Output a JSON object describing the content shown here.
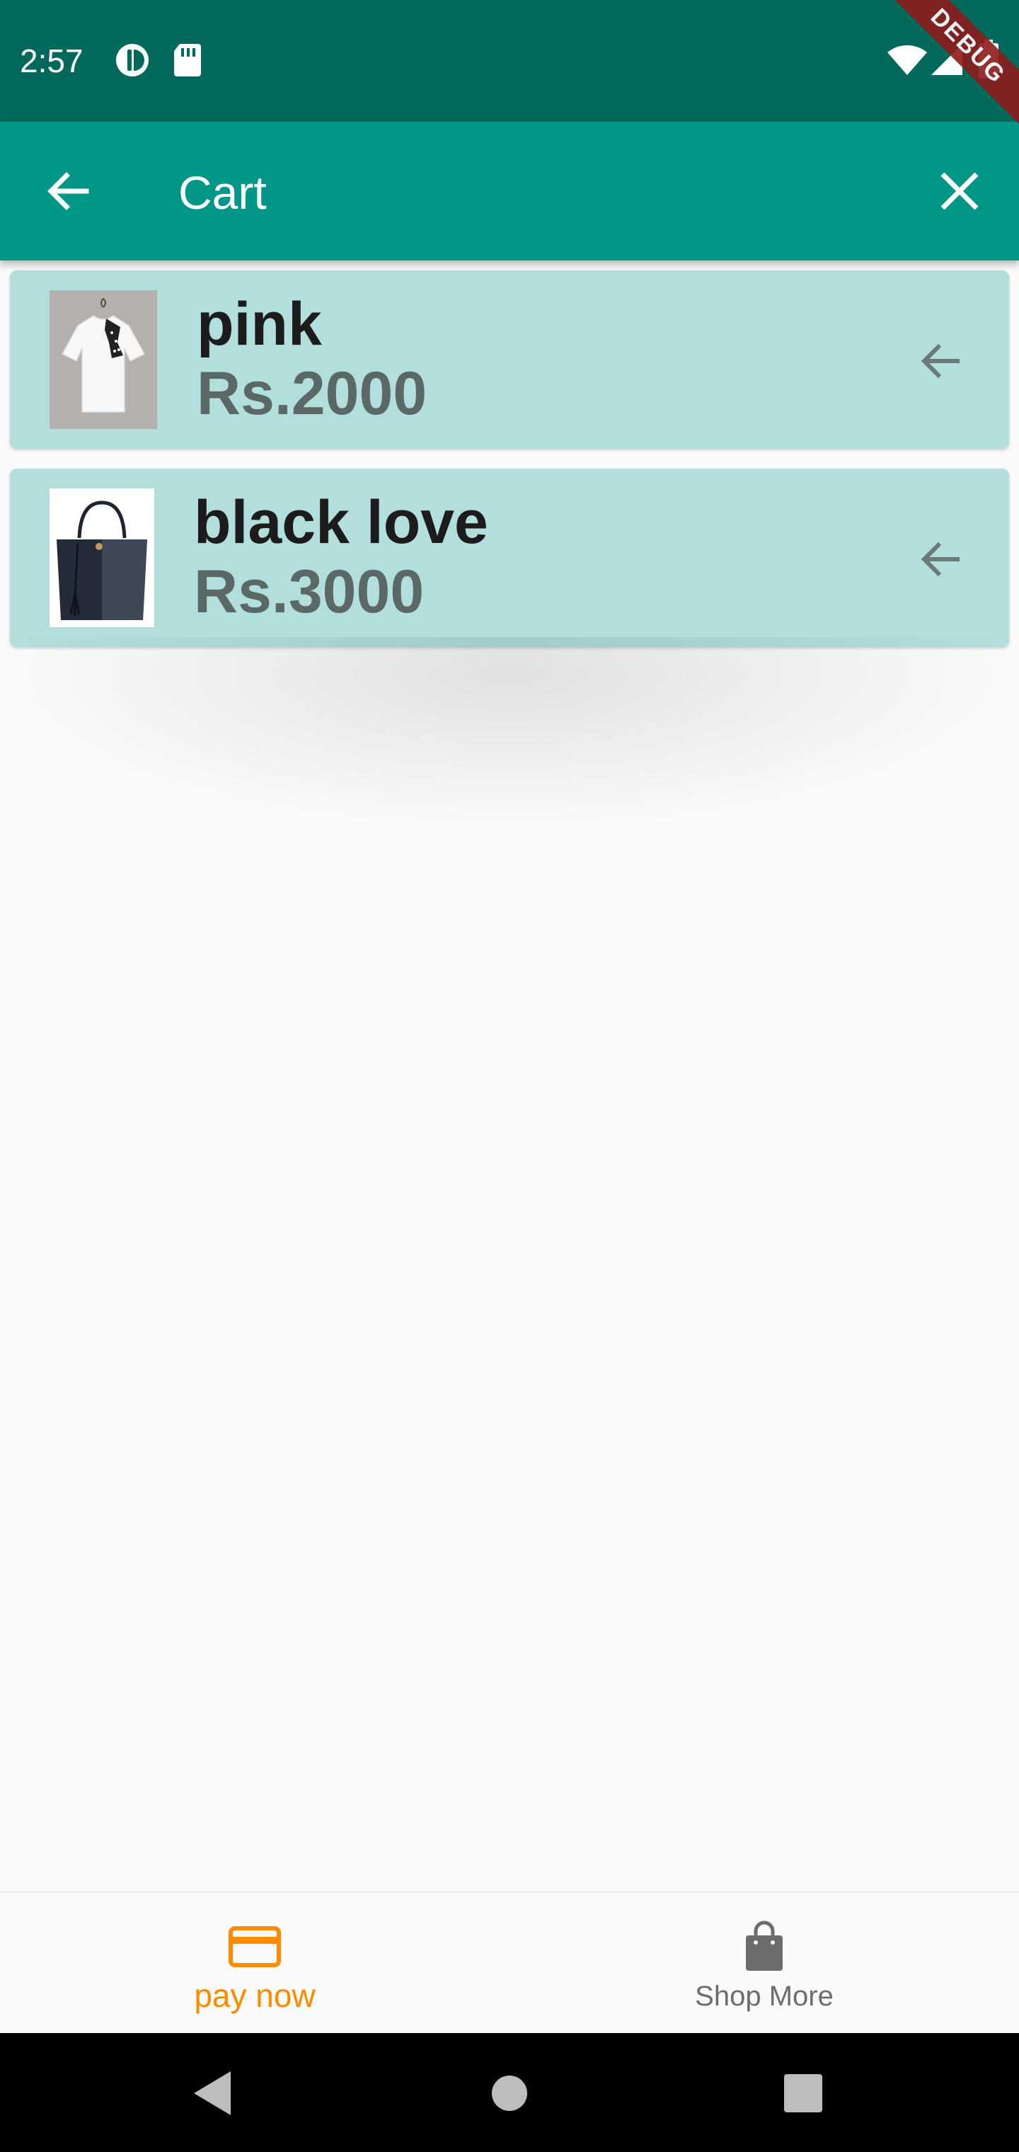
{
  "status_bar": {
    "time": "2:57",
    "icons": [
      "data-saver-icon",
      "sd-card-icon",
      "wifi-icon",
      "signal-icon",
      "battery-icon"
    ],
    "color": "#00695c"
  },
  "debug_banner": {
    "label": "DEBUG",
    "color": "#8e1b1b"
  },
  "app_bar": {
    "title": "Cart",
    "back_icon": "arrow-back-icon",
    "close_icon": "close-icon",
    "color": "#009688"
  },
  "cart": {
    "item_background": "#b2dfdb",
    "items": [
      {
        "name": "pink",
        "price": "Rs.2000",
        "image": "white-tshirt-thumbnail",
        "action_icon": "arrow-back-icon"
      },
      {
        "name": "black love",
        "price": "Rs.3000",
        "image": "black-handbag-thumbnail",
        "action_icon": "arrow-back-icon"
      }
    ]
  },
  "bottom_nav": {
    "items": [
      {
        "label": "pay now",
        "icon": "credit-card-icon",
        "active": true,
        "color": "#fb8c00"
      },
      {
        "label": "Shop More",
        "icon": "shopping-bag-icon",
        "active": false,
        "color": "#6d6d6d"
      }
    ]
  },
  "system_nav": {
    "buttons": [
      "back-triangle-icon",
      "home-circle-icon",
      "recents-square-icon"
    ]
  }
}
